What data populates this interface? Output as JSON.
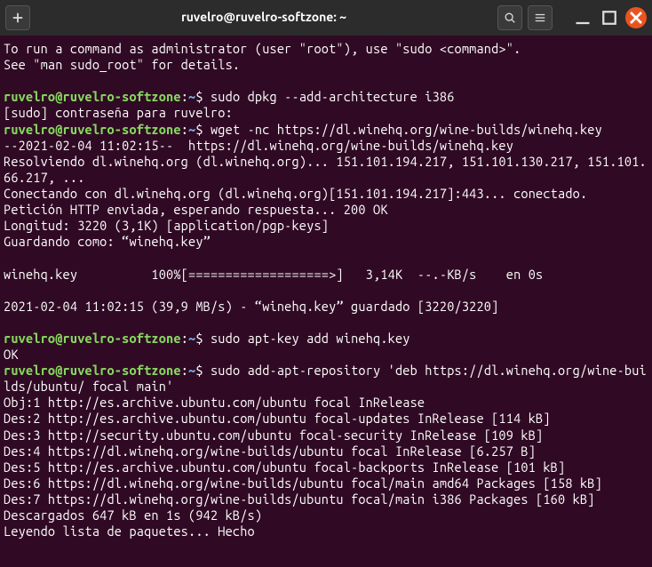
{
  "titlebar": {
    "title": "ruvelro@ruvelro-softzone: ~"
  },
  "prompt": {
    "user_host": "ruvelro@ruvelro-softzone",
    "colon": ":",
    "path": "~",
    "dollar": "$ "
  },
  "blocks": [
    {
      "type": "out",
      "lines": [
        "To run a command as administrator (user \"root\"), use \"sudo <command>\".",
        "See \"man sudo_root\" for details.",
        ""
      ]
    },
    {
      "type": "prompt",
      "cmd": "sudo dpkg --add-architecture i386",
      "out": [
        "[sudo] contraseña para ruvelro:"
      ]
    },
    {
      "type": "prompt",
      "cmd": "wget -nc https://dl.winehq.org/wine-builds/winehq.key",
      "out": [
        "--2021-02-04 11:02:15--  https://dl.winehq.org/wine-builds/winehq.key",
        "Resolviendo dl.winehq.org (dl.winehq.org)... 151.101.194.217, 151.101.130.217, 151.101.66.217, ...",
        "Conectando con dl.winehq.org (dl.winehq.org)[151.101.194.217]:443... conectado.",
        "Petición HTTP enviada, esperando respuesta... 200 OK",
        "Longitud: 3220 (3,1K) [application/pgp-keys]",
        "Guardando como: “winehq.key”",
        "",
        "winehq.key          100%[===================>]   3,14K  --.-KB/s    en 0s",
        "",
        "2021-02-04 11:02:15 (39,9 MB/s) - “winehq.key” guardado [3220/3220]",
        ""
      ]
    },
    {
      "type": "prompt",
      "cmd": "sudo apt-key add winehq.key",
      "out": [
        "OK"
      ]
    },
    {
      "type": "prompt",
      "cmd": "sudo add-apt-repository 'deb https://dl.winehq.org/wine-builds/ubuntu/ focal main'",
      "out": [
        "Obj:1 http://es.archive.ubuntu.com/ubuntu focal InRelease",
        "Des:2 http://es.archive.ubuntu.com/ubuntu focal-updates InRelease [114 kB]",
        "Des:3 http://security.ubuntu.com/ubuntu focal-security InRelease [109 kB]",
        "Des:4 https://dl.winehq.org/wine-builds/ubuntu focal InRelease [6.257 B]",
        "Des:5 http://es.archive.ubuntu.com/ubuntu focal-backports InRelease [101 kB]",
        "Des:6 https://dl.winehq.org/wine-builds/ubuntu focal/main amd64 Packages [158 kB]",
        "Des:7 https://dl.winehq.org/wine-builds/ubuntu focal/main i386 Packages [160 kB]",
        "Descargados 647 kB en 1s (942 kB/s)",
        "Leyendo lista de paquetes... Hecho"
      ]
    }
  ]
}
